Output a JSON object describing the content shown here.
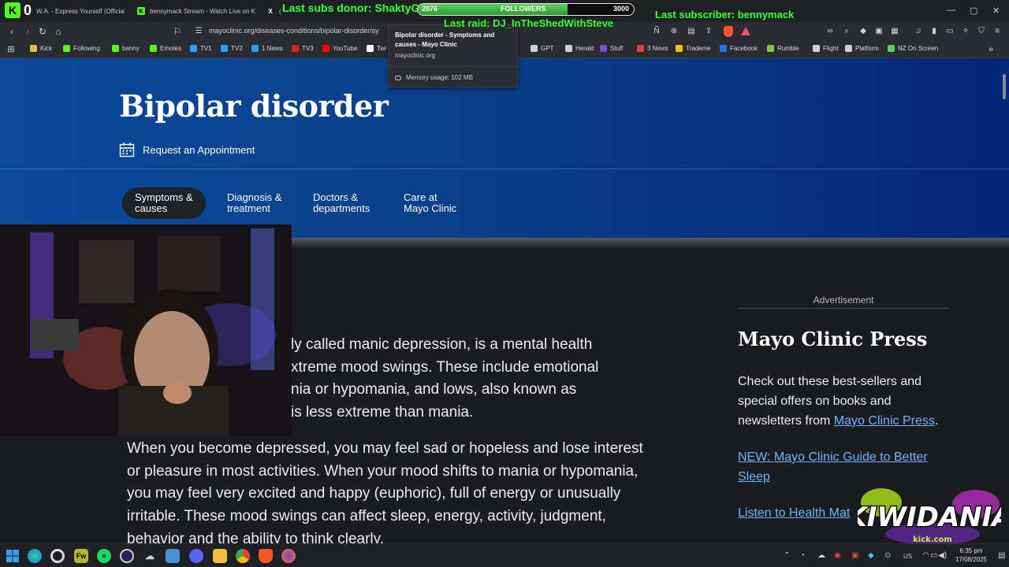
{
  "tabs": [
    {
      "label": "W.A. - Express Yourself (Official",
      "icon": "kick-icon"
    },
    {
      "label": "bennymack Stream - Watch Live on K",
      "icon": "kick-icon"
    },
    {
      "label": "(",
      "icon": "x-icon"
    }
  ],
  "address_bar": {
    "url": "mayoclinic.org/diseases-conditions/bipolar-disorder/sy"
  },
  "bookmarks": [
    {
      "label": "Kick",
      "icon": "folder-icon",
      "color": "#e8b84a"
    },
    {
      "label": "Following",
      "icon": "kick-icon",
      "color": "#53fc18"
    },
    {
      "label": "benny",
      "icon": "kick-icon",
      "color": "#53fc18"
    },
    {
      "label": "Emotes",
      "icon": "kick-icon",
      "color": "#53fc18"
    },
    {
      "label": "TV1",
      "icon": "plus-icon",
      "color": "#2a9df4"
    },
    {
      "label": "TV2",
      "icon": "plus-icon",
      "color": "#2a9df4"
    },
    {
      "label": "1 News",
      "icon": "plus-icon",
      "color": "#2a9df4"
    },
    {
      "label": "TV3",
      "icon": "tv3-icon",
      "color": "#d2232a"
    },
    {
      "label": "YouTube",
      "icon": "youtube-icon",
      "color": "#ff0000"
    },
    {
      "label": "Twi",
      "icon": "x-icon",
      "color": "#ffffff"
    },
    {
      "label": "GPT",
      "icon": "openai-icon",
      "color": "#cfcfcf"
    },
    {
      "label": "Herald",
      "icon": "herald-icon",
      "color": "#cfcfcf"
    },
    {
      "label": "Stuff",
      "icon": "stuff-icon",
      "color": "#7b4bd1"
    },
    {
      "label": "3 News",
      "icon": "news-icon",
      "color": "#e23b3b"
    },
    {
      "label": "Trademe",
      "icon": "trademe-icon",
      "color": "#f3c21b"
    },
    {
      "label": "Facebook",
      "icon": "facebook-icon",
      "color": "#1877f2"
    },
    {
      "label": "Rumble",
      "icon": "rumble-icon",
      "color": "#85c742"
    },
    {
      "label": "Flight",
      "icon": "flight-icon",
      "color": "#cfcfcf"
    },
    {
      "label": "Platform",
      "icon": "platform-icon",
      "color": "#cfcfcf"
    },
    {
      "label": "NZ On Screen",
      "icon": "nzonscreen-icon",
      "color": "#5ad25a"
    }
  ],
  "tooltip": {
    "title": "Bipolar disorder - Symptoms and causes - Mayo Clinic",
    "domain": "mayoclinic.org",
    "memory": "Memory usage: 102 MB"
  },
  "page": {
    "title": "Bipolar disorder",
    "appointment": "Request an Appointment",
    "nav_tabs": [
      {
        "line1": "Symptoms &",
        "line2": "causes",
        "active": true
      },
      {
        "line1": "Diagnosis &",
        "line2": "treatment",
        "active": false
      },
      {
        "line1": "Doctors &",
        "line2": "departments",
        "active": false
      },
      {
        "line1": "Care at",
        "line2": "Mayo Clinic",
        "active": false
      }
    ],
    "para1_lines": [
      "ly called manic depression, is a mental health",
      "xtreme mood swings. These include emotional",
      "nia or hypomania, and lows, also known as",
      "is less extreme than mania."
    ],
    "para2": "When you become depressed, you may feel sad or hopeless and lose interest or pleasure in most activities. When your mood shifts to mania or hypomania, you may feel very excited and happy (euphoric), full of energy or unusually irritable. These mood swings can affect sleep, energy, activity, judgment, behavior and the ability to think clearly."
  },
  "sidebar": {
    "ad_label": "Advertisement",
    "title": "Mayo Clinic Press",
    "desc_before": "Check out these best-sellers and special offers on books and newsletters from ",
    "desc_link": "Mayo Clinic Press",
    "desc_after": ".",
    "link1": "NEW: Mayo Clinic Guide to Better Sleep",
    "link2": "Listen to Health Mat"
  },
  "overlay": {
    "last_subs_donor": "Last subs donor: ShaktyG",
    "last_raid": "Last raid: DJ_InTheShedWithSteve",
    "last_subscriber": "Last subscriber: bennymack",
    "followers_current": "2076",
    "followers_label": "FOLLOWERS",
    "followers_goal": "3000",
    "followers_progress": 0.692,
    "logo_text": "KIWIDANIA",
    "logo_sub": "kick.com"
  },
  "taskbar": {
    "keyboard_lang": "US",
    "time": "6:35 pm",
    "date": "17/08/2025",
    "apps": [
      "start-icon",
      "edge-icon",
      "chrome-icon",
      "fw-icon",
      "spotify-icon",
      "obs-icon",
      "cloud-icon",
      "explorer-icon",
      "discord-icon",
      "folder-icon",
      "chrome-icon",
      "brave-icon",
      "firefox-icon"
    ]
  },
  "colors": {
    "hero_start": "#0a4a9a",
    "hero_end": "#05277a",
    "link": "#6fb3ff",
    "overlay_green": "#4df04d",
    "kick_green": "#53fc18"
  }
}
